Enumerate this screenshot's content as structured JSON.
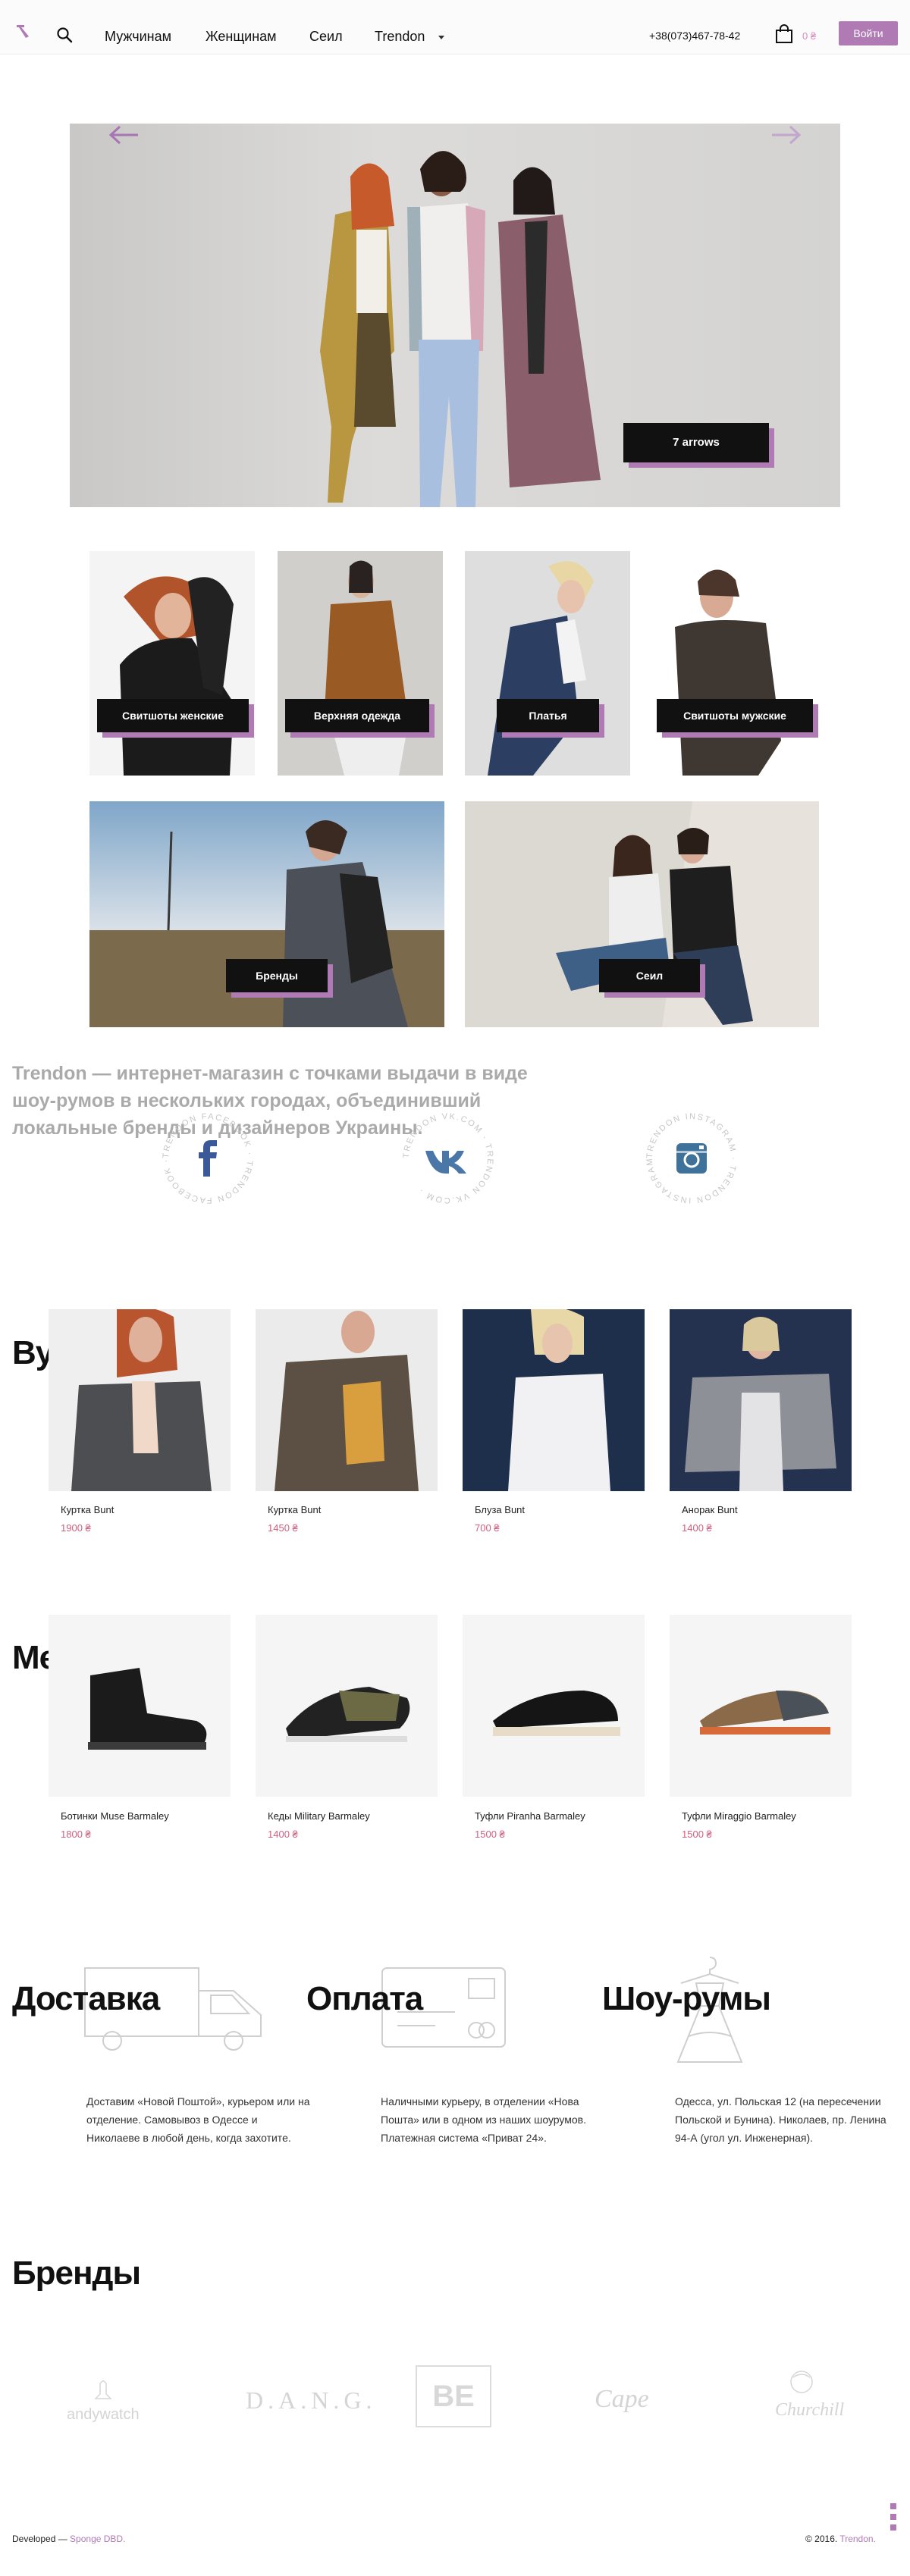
{
  "header": {
    "nav": [
      "Мужчинам",
      "Женщинам",
      "Сеил",
      "Trendon"
    ],
    "phone": "+38(073)467-78-42",
    "cart_count": "0 ₴",
    "login_label": "Войти"
  },
  "hero": {
    "cta_label": "7 arrows"
  },
  "categories": [
    {
      "label": "Свитшоты женские"
    },
    {
      "label": "Верхняя одежда"
    },
    {
      "label": "Платья"
    },
    {
      "label": "Свитшоты мужские"
    },
    {
      "label": "Бренды"
    },
    {
      "label": "Сеил"
    }
  ],
  "about": {
    "text": "Trendon — интернет-магазин с точками выдачи в виде шоу-румов в нескольких городах, объединивший локальные бренды и дизайнеров Украины."
  },
  "social": [
    {
      "icon": "facebook-icon",
      "ring_text": "TRENDON FACEBOOK · TRENDON FACEBOOK ·"
    },
    {
      "icon": "vk-icon",
      "ring_text": "TRENDON VK.COM · TRENDON VK.COM ·"
    },
    {
      "icon": "instagram-icon",
      "ring_text": "TRENDON INSTAGRAM · TRENDON INSTAGRAM ·"
    }
  ],
  "women": {
    "title": "Вумен",
    "products": [
      {
        "name": "Куртка Bunt",
        "price": "1900 ₴"
      },
      {
        "name": "Куртка Bunt",
        "price": "1450 ₴"
      },
      {
        "name": "Блуза Bunt",
        "price": "700 ₴"
      },
      {
        "name": "Анорак Bunt",
        "price": "1400 ₴"
      }
    ]
  },
  "men": {
    "title": "Мен",
    "products": [
      {
        "name": "Ботинки Muse Barmaley",
        "price": "1800 ₴"
      },
      {
        "name": "Кеды Military Barmaley",
        "price": "1400 ₴"
      },
      {
        "name": "Туфли Piranha Barmaley",
        "price": "1500 ₴"
      },
      {
        "name": "Туфли Miraggio Barmaley",
        "price": "1500 ₴"
      }
    ]
  },
  "info": [
    {
      "title": "Доставка",
      "icon": "truck-icon",
      "text": "Доставим «Новой Поштой», курьером или на отделение. Самовывоз в Одессе и Николаеве в любой день, когда захотите."
    },
    {
      "title": "Оплата",
      "icon": "credit-card-icon",
      "text": "Наличными курьеру, в отделении «Нова Пошта» или в одном из наших шоурумов. Платежная система «Приват 24»."
    },
    {
      "title": "Шоу-румы",
      "icon": "dress-hanger-icon",
      "text": "Одесса, ул. Польская 12 (на пересечении Польской и Бунина). Николаев, пр. Ленина 94-А (угол ул. Инженерная)."
    }
  ],
  "brands": {
    "title": "Бренды",
    "logos": [
      "andywatch",
      "D.A.N.G.",
      "BE",
      "Cape",
      "Churchill"
    ]
  },
  "footer": {
    "developed_label": "Developed — ",
    "developer": "Sponge DBD.",
    "copyright": "© 2016. ",
    "company": "Trendon."
  },
  "colors": {
    "accent": "#b07bb5",
    "price": "#d0607e",
    "header_bg": "#fbfbfb"
  }
}
